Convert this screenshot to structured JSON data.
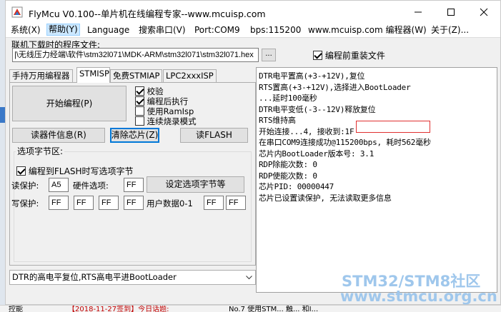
{
  "window": {
    "title": "FlyMcu V0.100--单片机在线编程专家--www.mcuisp.com"
  },
  "menu": [
    {
      "label": "系统(X)"
    },
    {
      "label": "帮助(Y)"
    },
    {
      "label": "Language"
    },
    {
      "label": "搜索串口(V)"
    },
    {
      "label": "Port:COM9"
    },
    {
      "label": "bps:115200"
    },
    {
      "label": "www.mcuisp.com 编程器(W)"
    },
    {
      "label": "关于(Z)..."
    }
  ],
  "file": {
    "label": "联机下载时的程序文件:",
    "path": "|\\无线压力经端\\软件\\stm32l071\\MDK-ARM\\stm32l071\\stm32l071.hex",
    "browse_label": "...",
    "reload_label": "编程前重装文件"
  },
  "tabs": [
    {
      "label": "手持万用编程器"
    },
    {
      "label": "STMISP"
    },
    {
      "label": "免费STMIAP"
    },
    {
      "label": "LPC2xxxISP"
    }
  ],
  "stmisp": {
    "start_button": "开始编程(P)",
    "options": [
      {
        "label": "校验",
        "checked": true
      },
      {
        "label": "编程后执行",
        "checked": true
      },
      {
        "label": "使用RamIsp",
        "checked": false
      },
      {
        "label": "连续烧录模式",
        "checked": false
      }
    ],
    "read_info_button": "读器件信息(R)",
    "erase_button": "清除芯片(Z)",
    "read_flash_button": "读FLASH",
    "option_bytes": {
      "title": "选项字节区:",
      "write_when_program_label": "编程到FLASH时写选项字节",
      "read_protect_label": "读保护:",
      "read_protect_value": "A5",
      "hw_option_label": "硬件选项:",
      "hw_option_value": "FF",
      "set_button": "设定选项字节等",
      "write_protect_label": "写保护:",
      "write_protect_values": [
        "FF",
        "FF",
        "FF",
        "FF"
      ],
      "user_data_label": "用户数据0-1",
      "user_data_values": [
        "FF",
        "FF"
      ]
    },
    "reset_mode": "DTR的高电平复位,RTS高电平进BootLoader"
  },
  "log": [
    "DTR电平置高(+3-+12V),复位",
    "RTS置高(+3-+12V),选择进入BootLoader",
    "...延时100毫秒",
    "DTR电平变低(-3--12V)释放复位",
    "RTS维持高",
    "开始连接...4, 接收到:1F",
    "在串口COM9连接成功@115200bps, 耗时562毫秒",
    "芯片内BootLoader版本号: 3.1",
    "RDP除能次数: 0",
    "RDP使能次数: 0",
    "芯片PID: 00000447",
    "芯片已设置读保护, 无法读取更多信息"
  ],
  "watermark": {
    "line1": "STM32/STM8社区",
    "line2": "www.stmcu.org.cn"
  },
  "background": {
    "bottom_text_1": "控能",
    "bottom_text_2": "【2018-11-27签到】今日话题:",
    "bottom_text_3": "No.7 使用STM... 触... 和I..."
  }
}
